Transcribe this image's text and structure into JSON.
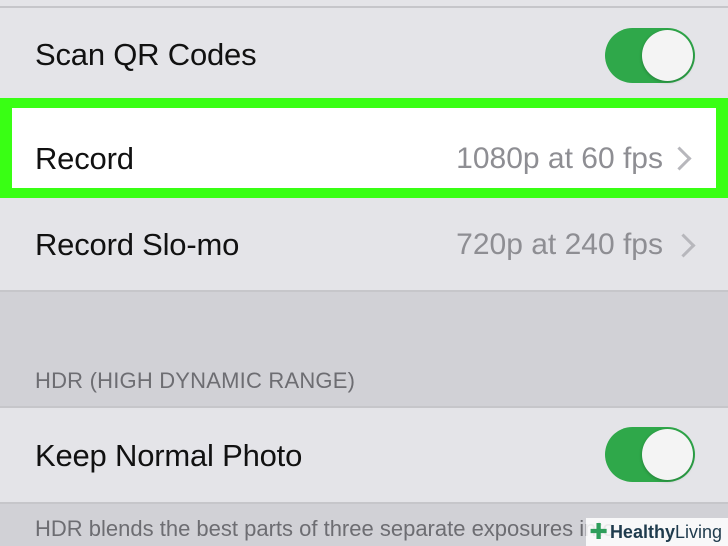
{
  "settings": {
    "scan_qr": {
      "label": "Scan QR Codes",
      "toggle_on": true
    },
    "record_video": {
      "label": "Record",
      "value": "1080p at 60 fps",
      "highlight_color": "#39ff14"
    },
    "record_slomo": {
      "label": "Record Slo-mo",
      "value": "720p at 240 fps"
    },
    "hdr_section": {
      "header": "HDR (HIGH DYNAMIC RANGE)",
      "keep_normal": {
        "label": "Keep Normal Photo",
        "toggle_on": true
      },
      "footer": "HDR blends the best parts of three separate exposures into"
    }
  },
  "watermark": {
    "part1": "Healthy",
    "part2": "Living"
  },
  "colors": {
    "toggle_green": "#2fa84a",
    "background": "#d1d1d6",
    "cell": "#e4e4e8"
  }
}
